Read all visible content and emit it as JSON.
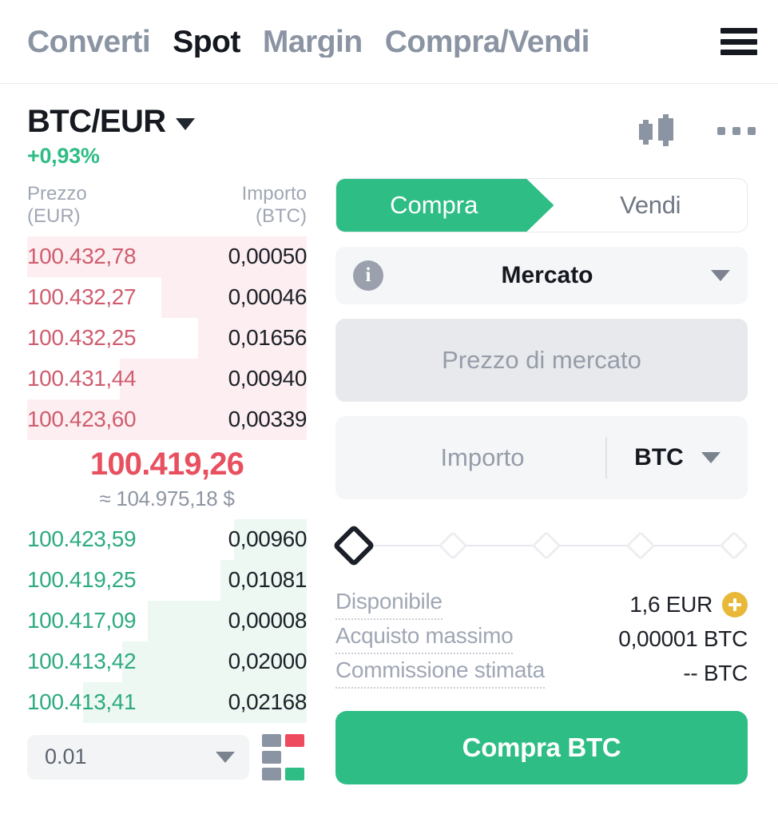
{
  "nav": {
    "tabs": [
      {
        "label": "Converti",
        "active": false
      },
      {
        "label": "Spot",
        "active": true
      },
      {
        "label": "Margin",
        "active": false
      },
      {
        "label": "Compra/Vendi",
        "active": false
      }
    ],
    "menu_icon": "hamburger-icon"
  },
  "pair": {
    "name": "BTC/EUR",
    "change": "+0,93%",
    "change_color": "#2ebd85",
    "chart_icon": "candlestick-chart-icon",
    "more_icon": "more-options-icon"
  },
  "orderbook": {
    "col_price": "Prezzo",
    "col_price_unit": "(EUR)",
    "col_amount": "Importo",
    "col_amount_unit": "(BTC)",
    "ask_color": "#cf5d6f",
    "bid_color": "#2eab80",
    "asks": [
      {
        "price": "100.432,78",
        "amount": "0,00050",
        "depth": 100
      },
      {
        "price": "100.432,27",
        "amount": "0,00046",
        "depth": 52
      },
      {
        "price": "100.432,25",
        "amount": "0,01656",
        "depth": 39
      },
      {
        "price": "100.431,44",
        "amount": "0,00940",
        "depth": 67
      },
      {
        "price": "100.423,60",
        "amount": "0,00339",
        "depth": 100
      }
    ],
    "bids": [
      {
        "price": "100.423,59",
        "amount": "0,00960",
        "depth": 26
      },
      {
        "price": "100.419,25",
        "amount": "0,01081",
        "depth": 31
      },
      {
        "price": "100.417,09",
        "amount": "0,00008",
        "depth": 57
      },
      {
        "price": "100.413,42",
        "amount": "0,02000",
        "depth": 66
      },
      {
        "price": "100.413,41",
        "amount": "0,02168",
        "depth": 80
      }
    ],
    "last_price": "100.419,26",
    "last_price_color": "#e8505f",
    "approx_price": "≈ 104.975,18 $",
    "grouping": "0.01",
    "depth_view_icon": "depth-view-toggle-icon"
  },
  "trade": {
    "tab_buy": "Compra",
    "tab_sell": "Vendi",
    "order_type": "Mercato",
    "order_type_info_icon": "info-icon",
    "price_placeholder": "Prezzo di mercato",
    "amount_placeholder": "Importo",
    "currency": "BTC",
    "slider_marks": 5,
    "slider_active_index": 0,
    "stats": [
      {
        "label": "Disponibile",
        "value": "1,6 EUR",
        "has_plus": true
      },
      {
        "label": "Acquisto massimo",
        "value": "0,00001 BTC",
        "has_plus": false
      },
      {
        "label": "Commissione stimata",
        "value": "-- BTC",
        "has_plus": false
      }
    ],
    "cta_label": "Compra BTC",
    "accent_color": "#2ebd85",
    "plus_badge_color": "#e8b838"
  }
}
